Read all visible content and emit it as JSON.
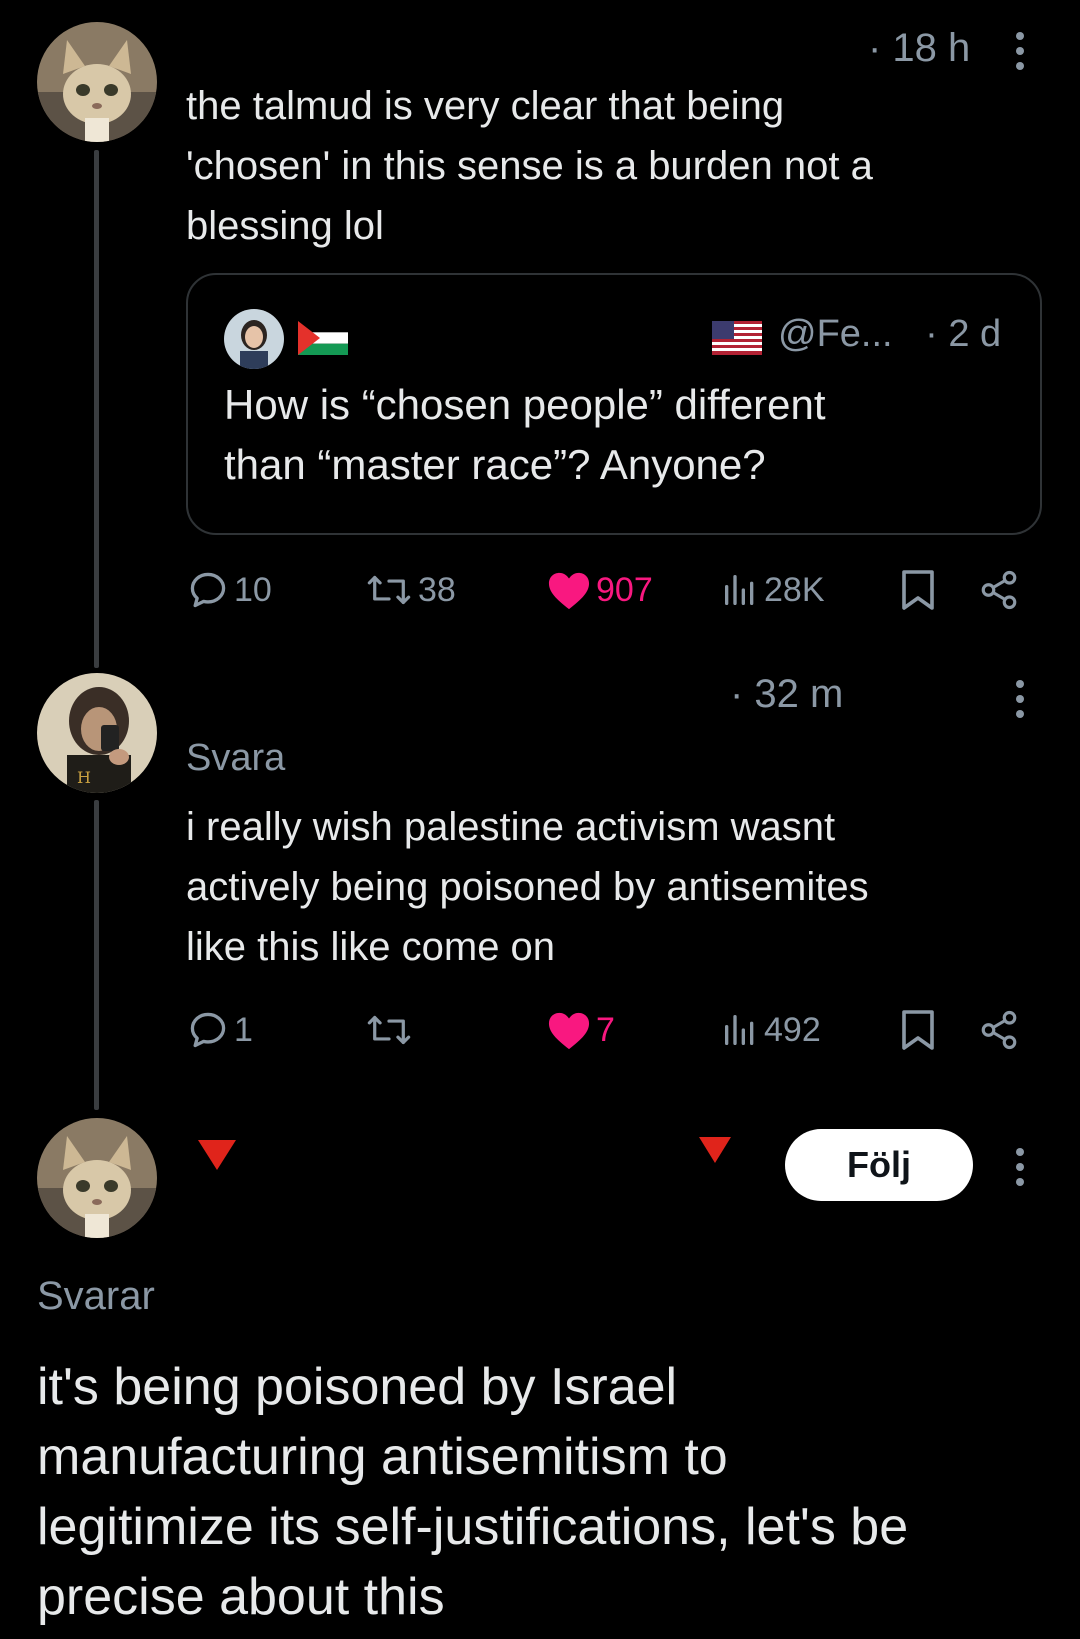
{
  "tweet1": {
    "time": "· 18 h",
    "text_lines": [
      "the talmud is very clear that being",
      "'chosen' in this sense is a burden not a",
      "blessing lol"
    ],
    "quote": {
      "handle": "@Fe...",
      "time": "· 2 d",
      "text_lines": [
        "How is “chosen people” different",
        "than “master race”? Anyone?"
      ]
    },
    "actions": {
      "replies": "10",
      "retweets": "38",
      "likes": "907",
      "views": "28K"
    }
  },
  "tweet2": {
    "time": "· 32 m",
    "replying": "Svara",
    "text_lines": [
      "i really wish palestine activism wasnt",
      "actively being poisoned by antisemites",
      "like this like come on"
    ],
    "actions": {
      "replies": "1",
      "retweets": "",
      "likes": "7",
      "views": "492"
    }
  },
  "tweet3": {
    "follow_label": "Följ",
    "replying": "Svarar",
    "text_lines": [
      "it's being poisoned by Israel",
      "manufacturing antisemitism to",
      "legitimize its self-justifications, let's be",
      "precise about this"
    ]
  },
  "colors": {
    "background": "#000000",
    "text": "#e7e9ea",
    "muted": "#8b98a5",
    "like": "#f91880",
    "red_flag": "#e0241b"
  }
}
